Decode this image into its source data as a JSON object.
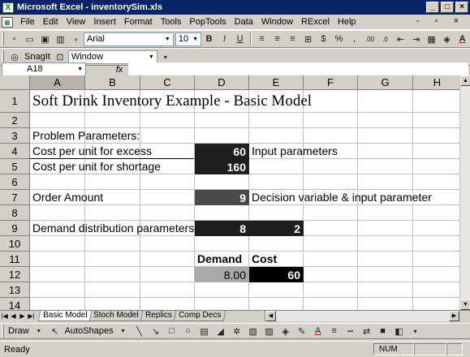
{
  "window": {
    "title": "Microsoft Excel - inventorySim.xls",
    "buttons": [
      "_",
      "□",
      "×"
    ]
  },
  "menu": {
    "items": [
      "File",
      "Edit",
      "View",
      "Insert",
      "Format",
      "Tools",
      "PopTools",
      "Data",
      "Window",
      "RExcel",
      "Help"
    ],
    "doc_controls": "- ▫ ×"
  },
  "formatting_toolbar": {
    "font": "Arial",
    "font_size": "10",
    "bold": "B",
    "italic": "I",
    "underline": "U",
    "currency": "$",
    "percent": "%",
    "comma": ",",
    "inc_decimal": ".00",
    "dec_decimal": ".0"
  },
  "snagit_toolbar": {
    "snagit_label": "SnagIt",
    "window_combo": "Window"
  },
  "formula_bar": {
    "name_box": "A18",
    "fx": "fx",
    "formula": ""
  },
  "columns": [
    "A",
    "B",
    "C",
    "D",
    "E",
    "F",
    "G",
    "H"
  ],
  "rows": [
    "1",
    "2",
    "3",
    "4",
    "5",
    "6",
    "7",
    "8",
    "9",
    "10",
    "11",
    "12",
    "13",
    "14"
  ],
  "cells": {
    "A1": "Soft Drink Inventory Example - Basic Model",
    "A3": "Problem Parameters:",
    "A4": "Cost per unit for excess",
    "D4": "60",
    "E4": "Input parameters",
    "A5": "Cost per unit for shortage",
    "D5": "160",
    "A7": "Order Amount",
    "D7": "9",
    "E7": "Decision variable & input parameter",
    "A9": "Demand distribution parameters",
    "D9": "8",
    "E9": "2",
    "D11": "Demand",
    "E11": "Cost",
    "D12": "8.00",
    "E12": "60"
  },
  "sheet_tabs": [
    "Basic Model",
    "Stoch Model",
    "Replics",
    "Comp Decs"
  ],
  "active_sheet": "Basic Model",
  "drawing_toolbar": {
    "draw": "Draw",
    "autoshapes": "AutoShapes"
  },
  "status": {
    "left": "Ready",
    "num": "NUM"
  }
}
